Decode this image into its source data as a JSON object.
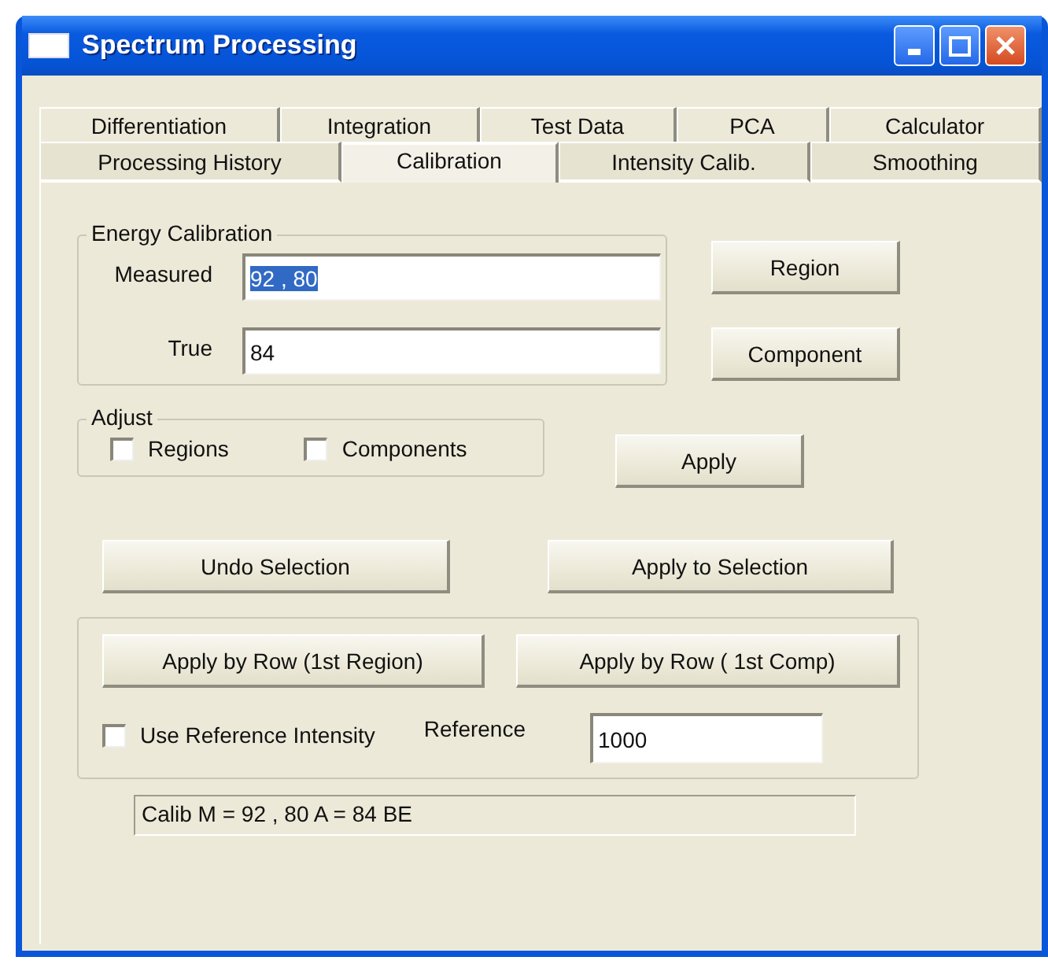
{
  "window": {
    "title": "Spectrum Processing"
  },
  "tabs": {
    "back_row": [
      {
        "label": "Differentiation",
        "selected": false
      },
      {
        "label": "Integration",
        "selected": false
      },
      {
        "label": "Test Data",
        "selected": false
      },
      {
        "label": "PCA",
        "selected": false
      },
      {
        "label": "Calculator",
        "selected": false
      }
    ],
    "front_row": [
      {
        "label": "Processing History",
        "selected": false
      },
      {
        "label": "Calibration",
        "selected": true
      },
      {
        "label": "Intensity Calib.",
        "selected": false
      },
      {
        "label": "Smoothing",
        "selected": false
      }
    ]
  },
  "energy_calibration": {
    "title": "Energy Calibration",
    "measured": {
      "label": "Measured",
      "value": "92 , 80",
      "text_selected": true
    },
    "true": {
      "label": "True",
      "value": "84"
    }
  },
  "region_button": "Region",
  "component_button": "Component",
  "adjust": {
    "title": "Adjust",
    "options": [
      {
        "label": "Regions",
        "checked": false
      },
      {
        "label": "Components",
        "checked": false
      }
    ]
  },
  "apply_button": "Apply",
  "undo_selection_button": "Undo Selection",
  "apply_to_selection_button": "Apply to Selection",
  "row_group": {
    "buttons": [
      "Apply by Row (1st Region)",
      "Apply by Row ( 1st Comp)"
    ],
    "use_reference": {
      "label": "Use Reference Intensity",
      "checked": false
    },
    "reference": {
      "label": "Reference",
      "value": "1000"
    }
  },
  "status": "Calib M = 92 , 80 A = 84 BE"
}
